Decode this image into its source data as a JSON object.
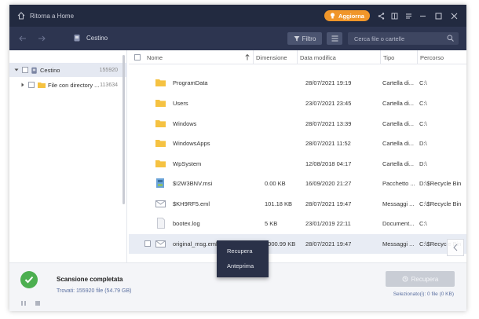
{
  "titlebar": {
    "home_label": "Ritorna a Home",
    "upgrade_label": "Aggiorna",
    "icons": [
      "share-icon",
      "feedback-icon",
      "menu-icon",
      "minimize-icon",
      "maximize-icon",
      "close-icon"
    ]
  },
  "toolbar": {
    "path_label": "Cestino",
    "filter_label": "Filtro",
    "search_placeholder": "Cerca file o cartelle"
  },
  "tree": {
    "items": [
      {
        "label": "Cestino",
        "count": "155920",
        "selected": true
      },
      {
        "label": "File con directory ...",
        "count": "113634",
        "selected": false
      }
    ]
  },
  "list": {
    "columns": [
      "Nome",
      "Dimensione",
      "Data modifica",
      "Tipo",
      "Percorso"
    ],
    "rows": [
      {
        "name": "ProgramData",
        "size": "",
        "date": "28/07/2021 19:19",
        "type": "Cartella di...",
        "path": "C:\\",
        "icon": "folder-icon"
      },
      {
        "name": "Users",
        "size": "",
        "date": "23/07/2021 23:45",
        "type": "Cartella di...",
        "path": "C:\\",
        "icon": "folder-icon"
      },
      {
        "name": "Windows",
        "size": "",
        "date": "28/07/2021 13:39",
        "type": "Cartella di...",
        "path": "C:\\",
        "icon": "folder-icon"
      },
      {
        "name": "WindowsApps",
        "size": "",
        "date": "28/07/2021 11:52",
        "type": "Cartella di...",
        "path": "D:\\",
        "icon": "folder-icon"
      },
      {
        "name": "WpSystem",
        "size": "",
        "date": "12/08/2018 04:17",
        "type": "Cartella di...",
        "path": "D:\\",
        "icon": "folder-icon"
      },
      {
        "name": "$I2W3BNV.msi",
        "size": "0.00 KB",
        "date": "16/09/2020 21:27",
        "type": "Pacchetto ...",
        "path": "D:\\$Recycle Bin",
        "icon": "installer-icon"
      },
      {
        "name": "$KH9RF5.eml",
        "size": "101.18 KB",
        "date": "28/07/2021 19:47",
        "type": "Messaggi ...",
        "path": "C:\\$Recycle Bin",
        "icon": "email-icon"
      },
      {
        "name": "bootex.log",
        "size": "5 KB",
        "date": "23/01/2019 22:11",
        "type": "Document...",
        "path": "C:\\",
        "icon": "document-icon"
      },
      {
        "name": "original_msg.eml",
        "size": "1000.99 KB",
        "date": "28/07/2021 19:47",
        "type": "Messaggi ...",
        "path": "C:\\$Recycle Bin",
        "icon": "email-icon",
        "selected": true
      }
    ]
  },
  "context_menu": {
    "items": [
      "Recupera",
      "Anteprima"
    ]
  },
  "bottom": {
    "scan_title": "Scansione completata",
    "scan_found": "Trovati: 155920 file (54.79 GB)",
    "recover_label": "Recupera",
    "selected_info": "Selezionato(i): 0 file (0 KB)"
  },
  "colors": {
    "titlebar": "#222a40",
    "toolbar": "#2d3550",
    "accent": "#f0962a",
    "success": "#4caf50",
    "folder": "#f5c242"
  }
}
